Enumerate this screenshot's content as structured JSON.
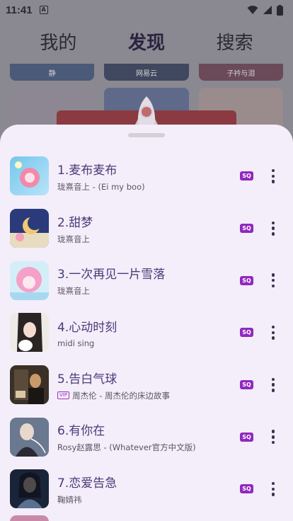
{
  "status_bar": {
    "time": "11:41",
    "notif_icon": "A"
  },
  "top_tabs": [
    {
      "label": "我的",
      "active": false
    },
    {
      "label": "发现",
      "active": true
    },
    {
      "label": "搜索",
      "active": false
    }
  ],
  "background_cards": [
    "静",
    "网易云",
    "子衿与泪"
  ],
  "songs": [
    {
      "title": "1.麦布麦布",
      "artist": "珑熹音上 - (Ei my boo)",
      "quality": "SQ",
      "vip": false,
      "cover_colors": [
        "#74c6ee",
        "#f08aa8"
      ]
    },
    {
      "title": "2.甜梦",
      "artist": "珑熹音上",
      "quality": "SQ",
      "vip": false,
      "cover_colors": [
        "#2a3a7a",
        "#f0c870"
      ]
    },
    {
      "title": "3.一次再见一片雪落",
      "artist": "珑熹音上",
      "quality": "SQ",
      "vip": false,
      "cover_colors": [
        "#f4a0c8",
        "#a8d8f0"
      ]
    },
    {
      "title": "4.心动时刻",
      "artist": "midi sing",
      "quality": "SQ",
      "vip": false,
      "cover_colors": [
        "#e8e4e0",
        "#2a2424"
      ]
    },
    {
      "title": "5.告白气球",
      "artist": "周杰伦 - 周杰伦的床边故事",
      "quality": "SQ",
      "vip": true,
      "vip_label": "VIP",
      "cover_colors": [
        "#3a3028",
        "#c89a68"
      ]
    },
    {
      "title": "6.有你在",
      "artist": "Rosy赵露思 - (Whatever官方中文版)",
      "quality": "SQ",
      "vip": false,
      "cover_colors": [
        "#6a7890",
        "#d8d0c8"
      ]
    },
    {
      "title": "7.恋爱告急",
      "artist": "鞠婧祎",
      "quality": "SQ",
      "vip": false,
      "cover_colors": [
        "#1a2438",
        "#5a7090"
      ]
    }
  ]
}
